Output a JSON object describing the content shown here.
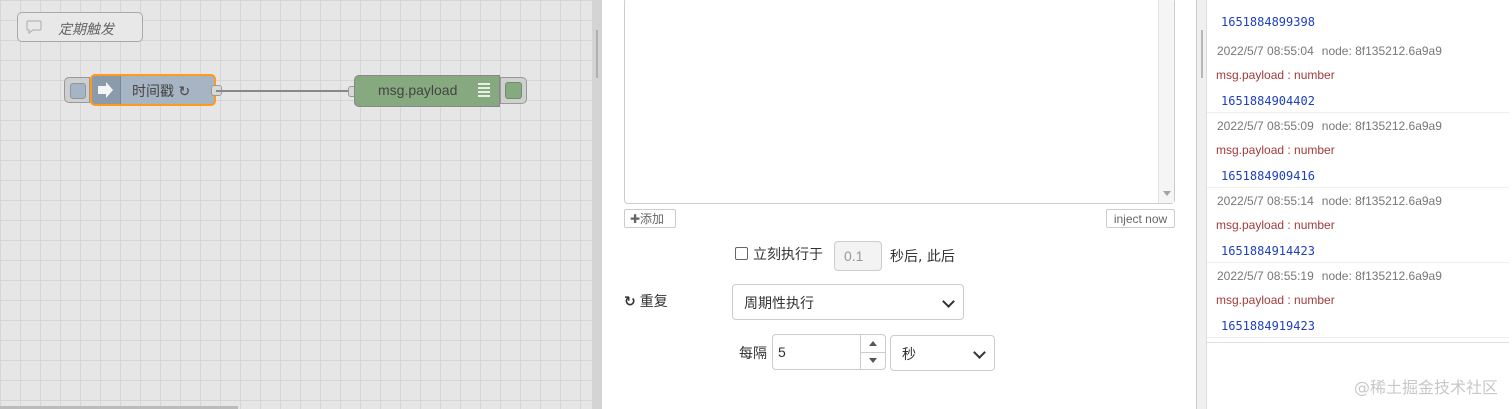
{
  "canvas": {
    "comment_label": "定期触发",
    "inject_node_label": "时间戳 ↻",
    "debug_node_label": "msg.payload"
  },
  "tray": {
    "add_button": "✚添加",
    "inject_now_button": "inject now",
    "once_checkbox_label": "立刻执行于",
    "once_delay_value": "0.1",
    "once_delay_suffix": "秒后, 此后",
    "repeat_label": "重复",
    "repeat_value": "周期性执行",
    "interval_label": "每隔",
    "interval_value": "5",
    "interval_unit": "秒"
  },
  "debug": {
    "first_value": "1651884899398",
    "messages": [
      {
        "time": "2022/5/7 08:55:04",
        "node": "node: 8f135212.6a9a9",
        "topic": "msg.payload : number",
        "value": "1651884904402"
      },
      {
        "time": "2022/5/7 08:55:09",
        "node": "node: 8f135212.6a9a9",
        "topic": "msg.payload : number",
        "value": "1651884909416"
      },
      {
        "time": "2022/5/7 08:55:14",
        "node": "node: 8f135212.6a9a9",
        "topic": "msg.payload : number",
        "value": "1651884914423"
      },
      {
        "time": "2022/5/7 08:55:19",
        "node": "node: 8f135212.6a9a9",
        "topic": "msg.payload : number",
        "value": "1651884919423"
      }
    ]
  },
  "watermark": "@稀土掘金技术社区",
  "colors": {
    "inject_node": "#a6b4c3",
    "debug_node": "#87a980",
    "selected_border": "#ff9a1a",
    "topic_text": "#a23b3b",
    "value_text": "#1f3fbd"
  }
}
